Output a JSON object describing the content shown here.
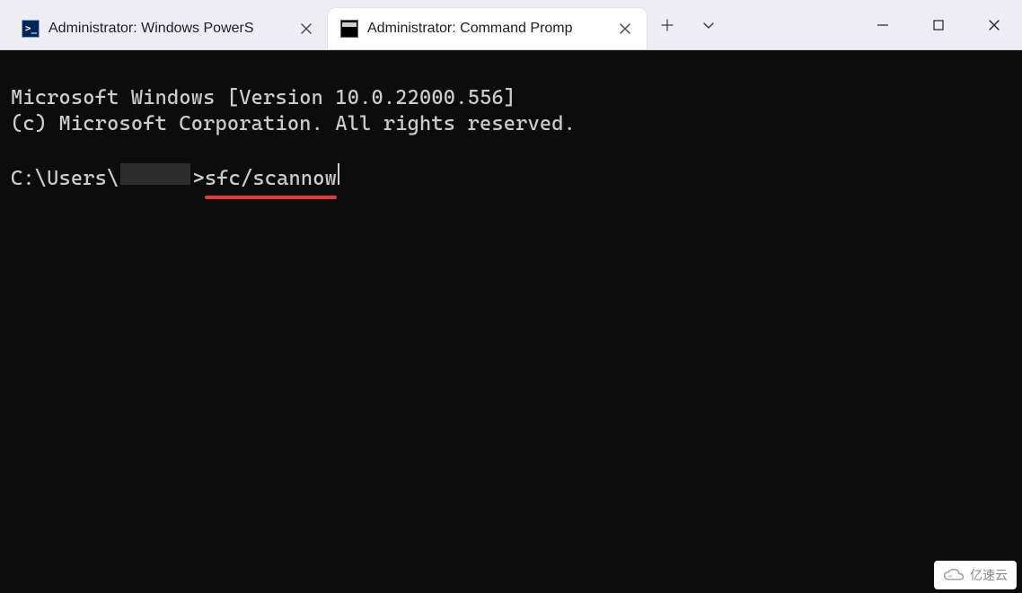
{
  "tabs": [
    {
      "title": "Administrator: Windows PowerS",
      "icon": "powershell",
      "active": false
    },
    {
      "title": "Administrator: Command Promp",
      "icon": "cmd",
      "active": true
    }
  ],
  "terminal": {
    "version_line": "Microsoft Windows [Version 10.0.22000.556]",
    "copyright_line": "(c) Microsoft Corporation. All rights reserved.",
    "prompt_prefix": "C:\\Users\\",
    "prompt_suffix": ">",
    "command": "sfc/scannow"
  },
  "watermark_text": "亿速云"
}
